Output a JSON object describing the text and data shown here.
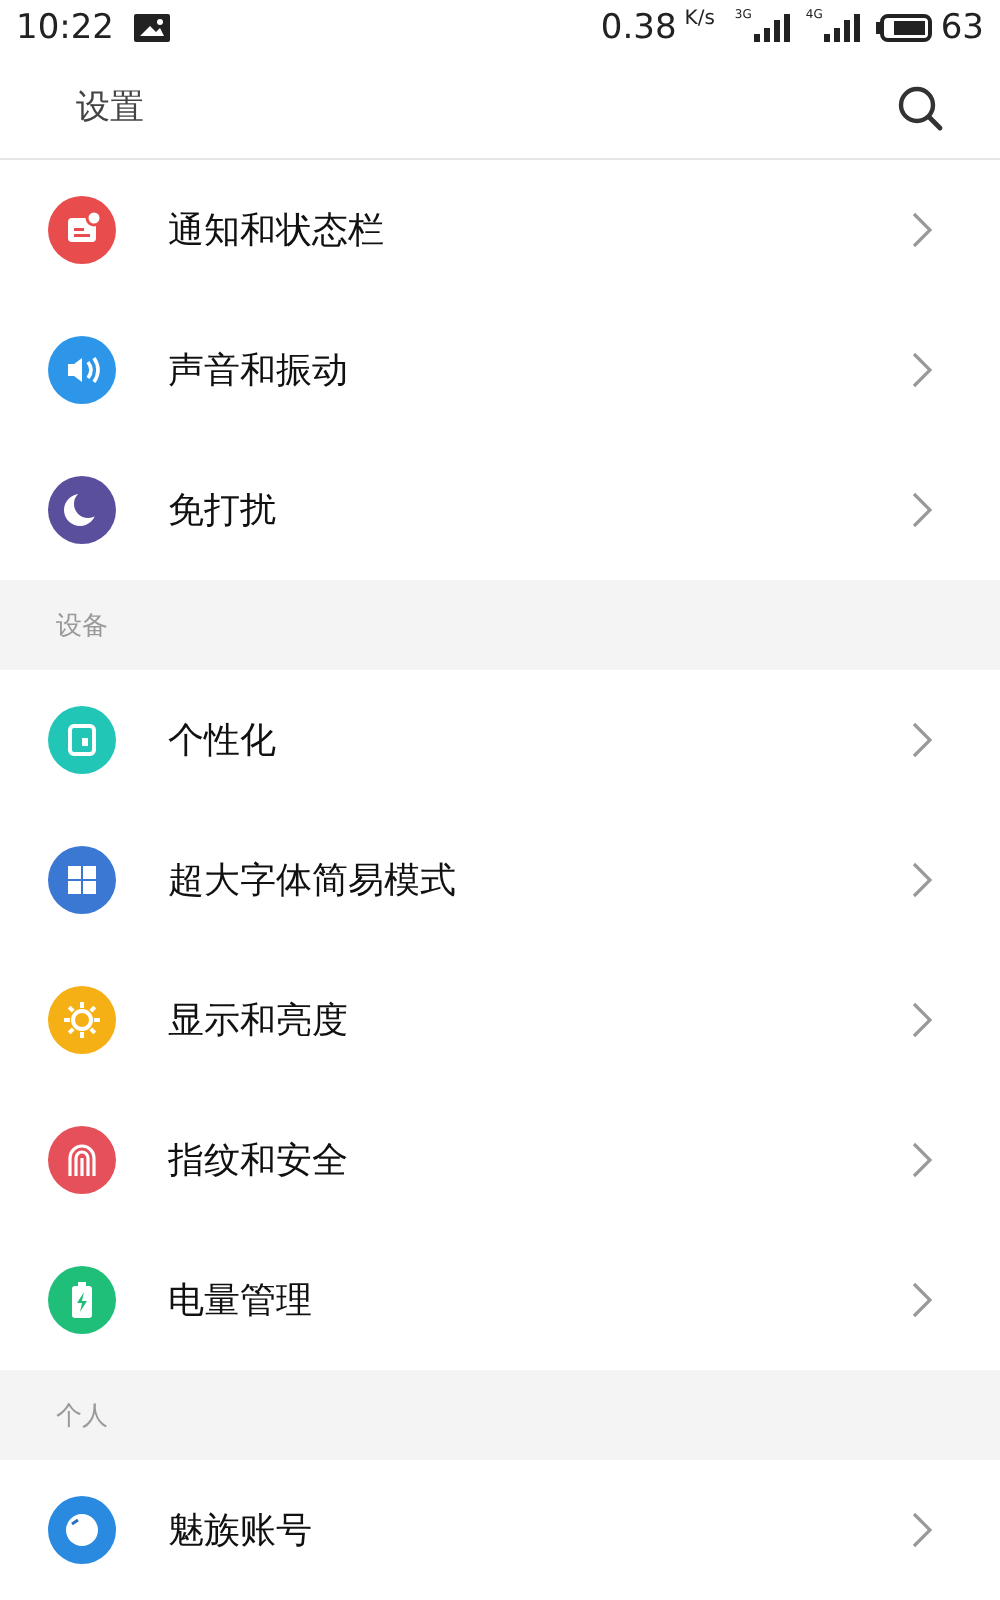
{
  "status_bar": {
    "time": "10:22",
    "speed": "0.38",
    "speed_unit": "K/s",
    "networks": [
      {
        "label": "3G"
      },
      {
        "label": "4G"
      }
    ],
    "battery": "63"
  },
  "header": {
    "title": "设置"
  },
  "sections": [
    {
      "items": [
        {
          "label": "通知和状态栏",
          "kind": "notification",
          "color": "#e84c4c"
        },
        {
          "label": "声音和振动",
          "kind": "sound",
          "color": "#2d96e8"
        },
        {
          "label": "免打扰",
          "kind": "moon",
          "color": "#5a4f9c"
        }
      ]
    },
    {
      "title": "设备",
      "items": [
        {
          "label": "个性化",
          "kind": "theme",
          "color": "#22c6b6"
        },
        {
          "label": "超大字体简易模式",
          "kind": "grid",
          "color": "#3a78d4"
        },
        {
          "label": "显示和亮度",
          "kind": "sun",
          "color": "#f5b015"
        },
        {
          "label": "指纹和安全",
          "kind": "fingerprint",
          "color": "#e5505a"
        },
        {
          "label": "电量管理",
          "kind": "battery",
          "color": "#1fbf7a"
        }
      ]
    },
    {
      "title": "个人",
      "items": [
        {
          "label": "魅族账号",
          "kind": "account",
          "color": "#2a8ae0"
        }
      ]
    }
  ]
}
